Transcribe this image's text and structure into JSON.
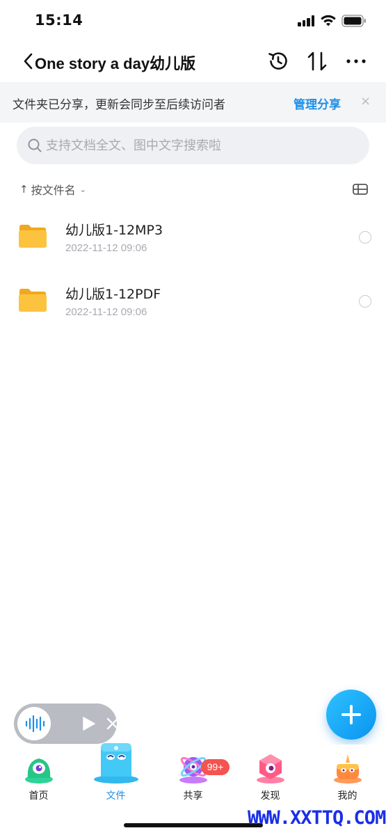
{
  "status_bar": {
    "time": "15:14"
  },
  "nav": {
    "title": "One story a day幼儿版"
  },
  "share_banner": {
    "text": "文件夹已分享，更新会同步至后续访问者",
    "action": "管理分享",
    "close": "×"
  },
  "search": {
    "placeholder": "支持文档全文、图中文字搜索啦"
  },
  "sort": {
    "arrow": "↑",
    "label": "按文件名",
    "caret": "⌄"
  },
  "files": [
    {
      "name": "幼儿版1-12MP3",
      "date": "2022-11-12 09:06"
    },
    {
      "name": "幼儿版1-12PDF",
      "date": "2022-11-12 09:06"
    }
  ],
  "tabs": [
    {
      "label": "首页"
    },
    {
      "label": "文件"
    },
    {
      "label": "共享"
    },
    {
      "label": "发现"
    },
    {
      "label": "我的"
    }
  ],
  "share_badge": "99+",
  "watermark": "WWW.XXTTQ.COM",
  "colors": {
    "accent": "#1e8fe8",
    "badge": "#f5534f",
    "folder": "#fcc43e"
  }
}
